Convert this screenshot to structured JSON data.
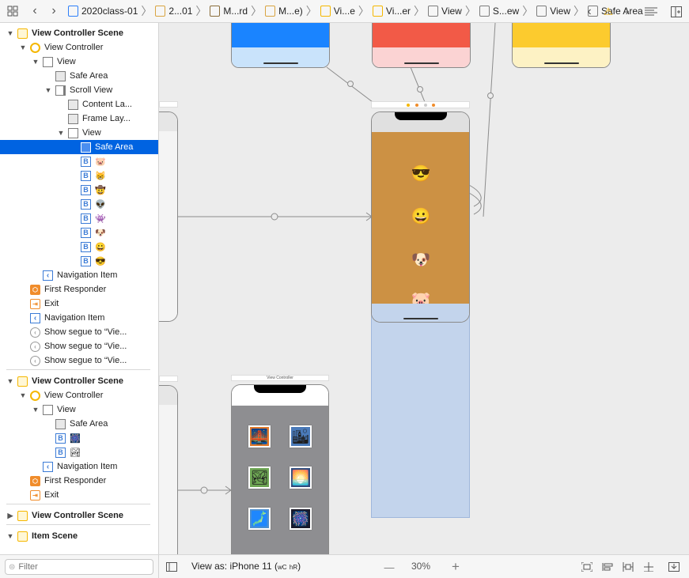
{
  "jumpbar": {
    "crumbs": [
      {
        "label": "2020class-01",
        "icon": "project-icon",
        "color": "#2d7ff9"
      },
      {
        "label": "2...01",
        "icon": "folder-icon",
        "color": "#d9a441"
      },
      {
        "label": "M...rd",
        "icon": "storyboard-icon",
        "color": "#8a6d3b"
      },
      {
        "label": "M...e)",
        "icon": "storyboard-base-icon",
        "color": "#d9a441"
      },
      {
        "label": "Vi...e",
        "icon": "scene-icon",
        "color": "#f5b700"
      },
      {
        "label": "Vi...er",
        "icon": "view-controller-icon",
        "color": "#f5b700"
      },
      {
        "label": "View",
        "icon": "view-icon",
        "color": "#7d7d7d"
      },
      {
        "label": "S...ew",
        "icon": "scroll-view-icon",
        "color": "#7d7d7d"
      },
      {
        "label": "View",
        "icon": "view-icon",
        "color": "#7d7d7d"
      },
      {
        "label": "Safe Area",
        "icon": "safe-area-icon",
        "color": "#7d7d7d"
      }
    ]
  },
  "outline": {
    "rows": [
      {
        "label": "View Controller Scene",
        "type": "scene",
        "indent": 0,
        "tri": "▼"
      },
      {
        "label": "View Controller",
        "type": "vc",
        "indent": 1,
        "tri": "▼"
      },
      {
        "label": "View",
        "type": "view",
        "indent": 2,
        "tri": "▼"
      },
      {
        "label": "Safe Area",
        "type": "safe",
        "indent": 3,
        "tri": ""
      },
      {
        "label": "Scroll View",
        "type": "scroll",
        "indent": 3,
        "tri": "▼"
      },
      {
        "label": "Content La...",
        "type": "safe",
        "indent": 4,
        "tri": ""
      },
      {
        "label": "Frame Lay...",
        "type": "safe",
        "indent": 4,
        "tri": ""
      },
      {
        "label": "View",
        "type": "view",
        "indent": 4,
        "tri": "▼"
      },
      {
        "label": "Safe Area",
        "type": "safe-sel",
        "indent": 5,
        "tri": "",
        "selected": true
      },
      {
        "label": "🐷",
        "type": "b",
        "indent": 5,
        "tri": ""
      },
      {
        "label": "😸",
        "type": "b",
        "indent": 5,
        "tri": ""
      },
      {
        "label": "🤠",
        "type": "b",
        "indent": 5,
        "tri": ""
      },
      {
        "label": "👽",
        "type": "b",
        "indent": 5,
        "tri": ""
      },
      {
        "label": "👾",
        "type": "b",
        "indent": 5,
        "tri": ""
      },
      {
        "label": "🐶",
        "type": "b",
        "indent": 5,
        "tri": ""
      },
      {
        "label": "😀",
        "type": "b",
        "indent": 5,
        "tri": ""
      },
      {
        "label": "😎",
        "type": "b",
        "indent": 5,
        "tri": ""
      },
      {
        "label": "Navigation Item",
        "type": "nav",
        "indent": 2,
        "tri": ""
      },
      {
        "label": "First Responder",
        "type": "fr",
        "indent": 1,
        "tri": ""
      },
      {
        "label": "Exit",
        "type": "exit",
        "indent": 1,
        "tri": ""
      },
      {
        "label": "Navigation Item",
        "type": "nav",
        "indent": 1,
        "tri": ""
      },
      {
        "label": "Show segue to “Vie...",
        "type": "segue",
        "indent": 1,
        "tri": ""
      },
      {
        "label": "Show segue to “Vie...",
        "type": "segue",
        "indent": 1,
        "tri": ""
      },
      {
        "label": "Show segue to “Vie...",
        "type": "segue",
        "indent": 1,
        "tri": ""
      },
      {
        "label": "",
        "type": "divider"
      },
      {
        "label": "View Controller Scene",
        "type": "scene",
        "indent": 0,
        "tri": "▼"
      },
      {
        "label": "View Controller",
        "type": "vc",
        "indent": 1,
        "tri": "▼"
      },
      {
        "label": "View",
        "type": "view",
        "indent": 2,
        "tri": "▼"
      },
      {
        "label": "Safe Area",
        "type": "safe",
        "indent": 3,
        "tri": ""
      },
      {
        "label": "🎆",
        "type": "b",
        "indent": 3,
        "tri": ""
      },
      {
        "label": "🏞",
        "type": "b",
        "indent": 3,
        "tri": ""
      },
      {
        "label": "Navigation Item",
        "type": "nav",
        "indent": 2,
        "tri": ""
      },
      {
        "label": "First Responder",
        "type": "fr",
        "indent": 1,
        "tri": ""
      },
      {
        "label": "Exit",
        "type": "exit",
        "indent": 1,
        "tri": ""
      },
      {
        "label": "",
        "type": "divider"
      },
      {
        "label": "View Controller Scene",
        "type": "scene",
        "indent": 0,
        "tri": "▶"
      },
      {
        "label": "",
        "type": "divider"
      },
      {
        "label": "Item Scene",
        "type": "scene",
        "indent": 0,
        "tri": "▼"
      }
    ]
  },
  "filter": {
    "placeholder": "Filter"
  },
  "canvas": {
    "emojis_main": [
      "😎",
      "😀",
      "🐶",
      "🐷"
    ],
    "small_scene_title": "View Controller",
    "thumbs": [
      "🌉",
      "🏙",
      "🏞",
      "🌅",
      "🗾",
      "🎆"
    ],
    "colors": {
      "blue": "#1a84ff",
      "red": "#f25a47",
      "yellow": "#fccb2e",
      "brown": "#cc9144",
      "gray": "#8e8e91",
      "selection": "#c3d4ec"
    }
  },
  "canvasbar": {
    "view_as": "View as: iPhone 11 (",
    "size_class_w": "wC",
    "size_class_h": "hR",
    "view_as_end": ")",
    "zoom": "30%",
    "zoom_out": "—",
    "zoom_in": "+"
  }
}
